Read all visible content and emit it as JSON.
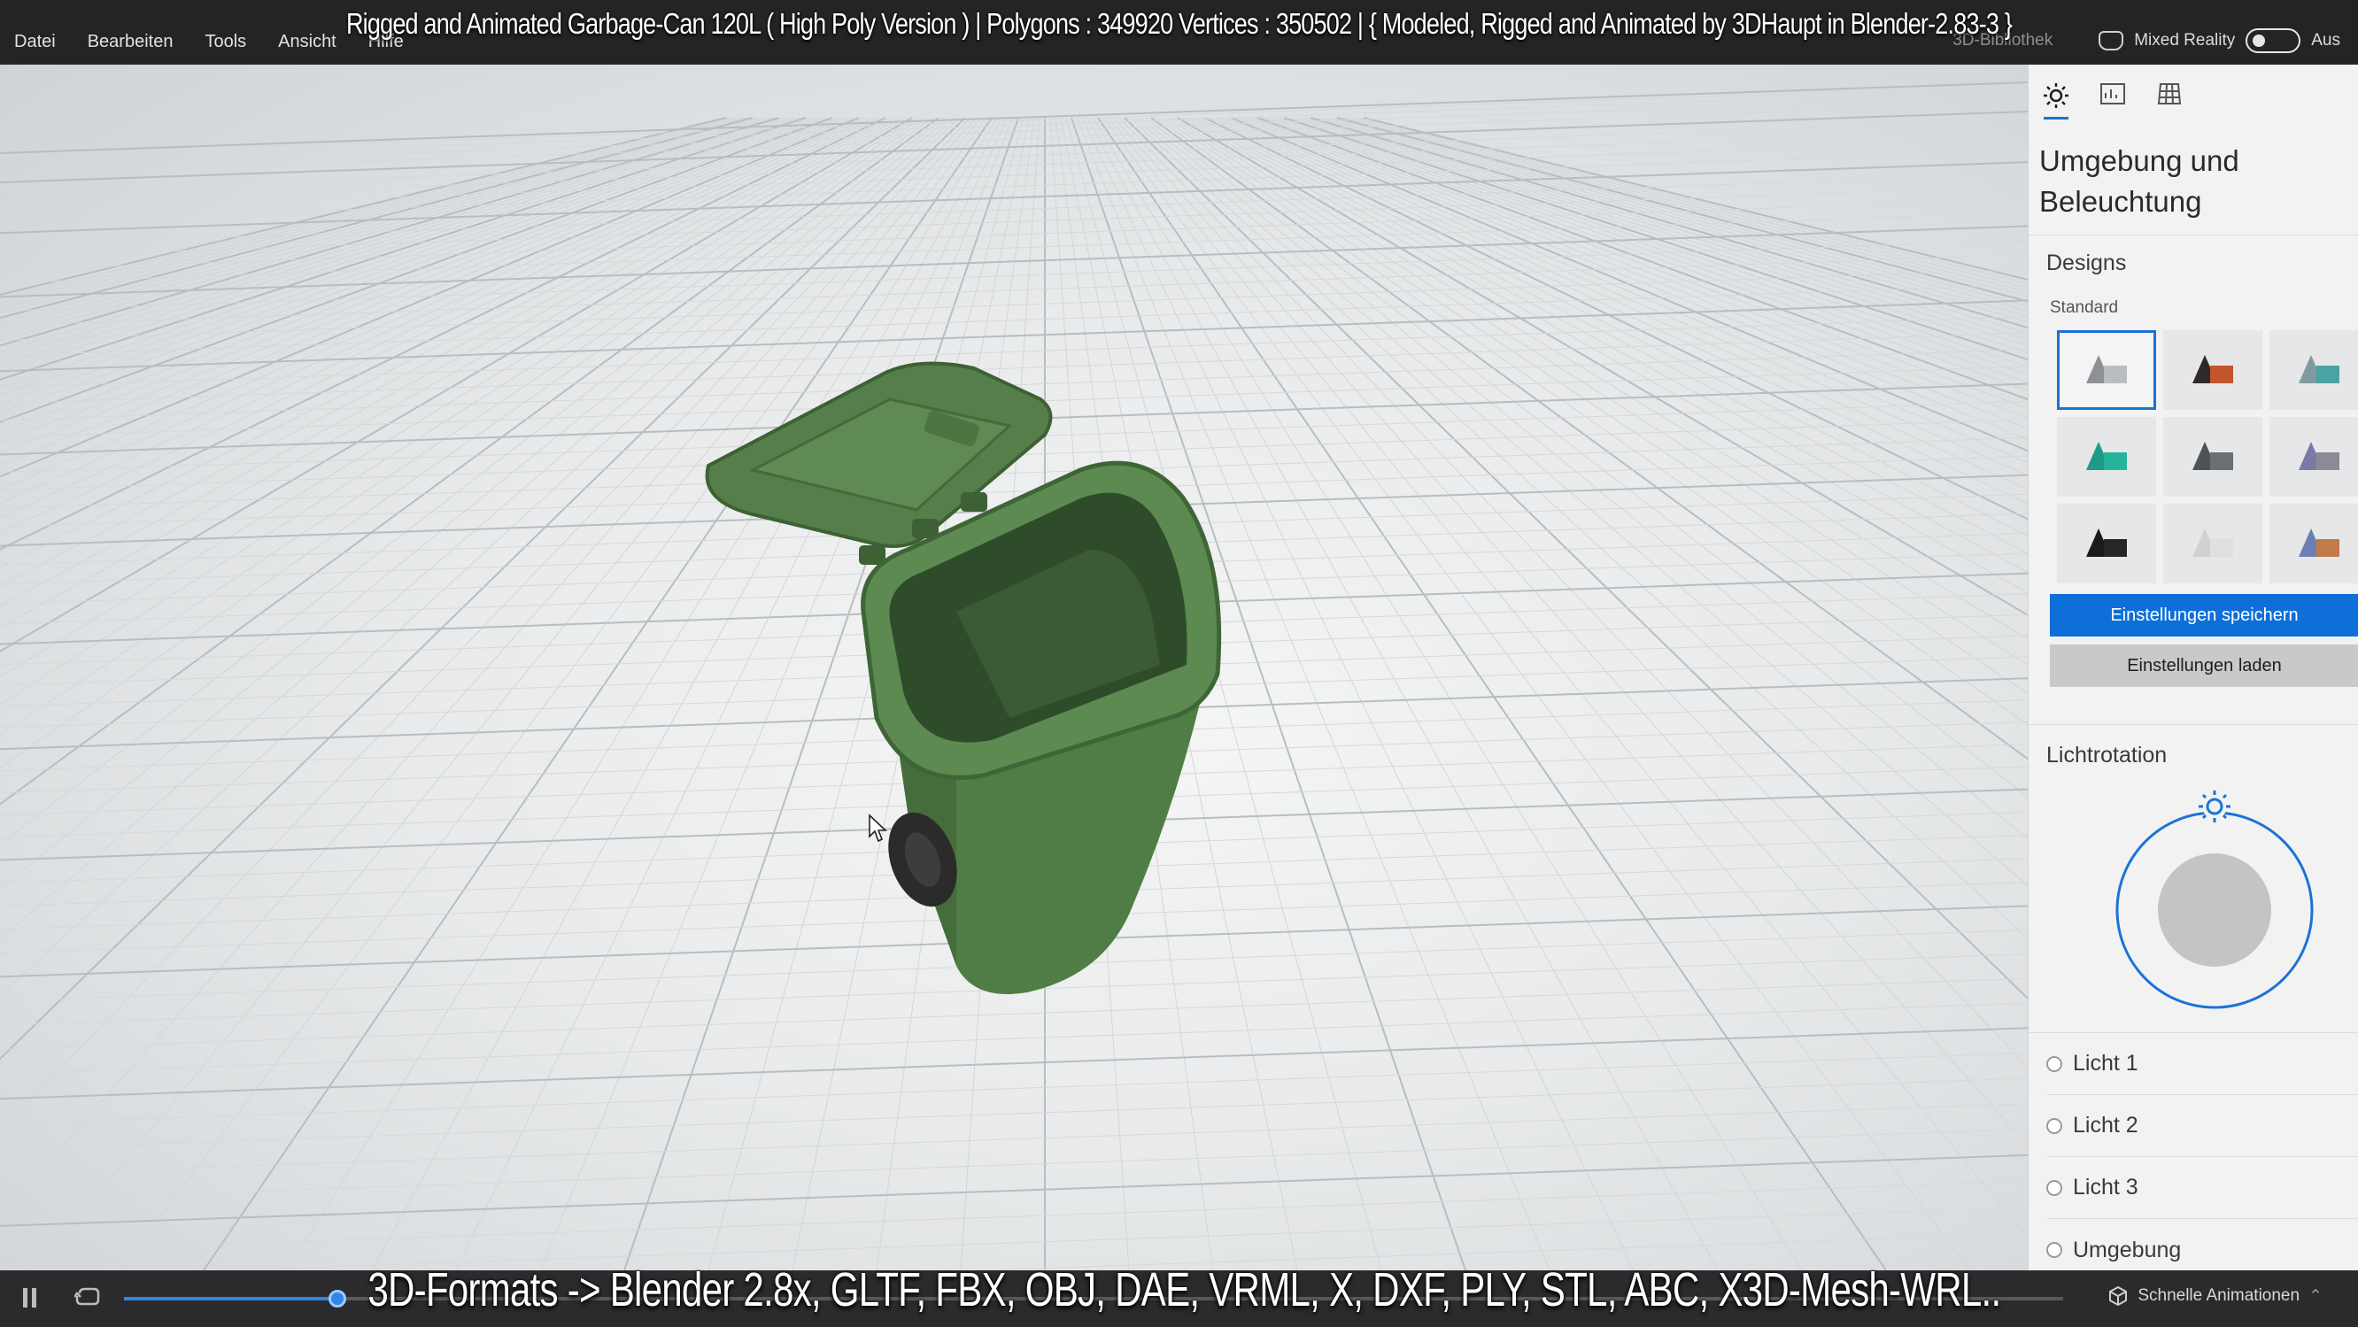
{
  "menu": {
    "items": [
      "Datei",
      "Bearbeiten",
      "Tools",
      "Ansicht",
      "Hilfe"
    ]
  },
  "overlay": {
    "title": "Rigged and Animated Garbage-Can 120L ( High Poly Version )  |  Polygons : 349920  Vertices : 350502   |   { Modeled, Rigged and Animated by 3DHaupt in Blender-2.83-3 }",
    "formats": "3D-Formats -> Blender 2.8x, GLTF, FBX, OBJ, DAE, VRML, X, DXF, PLY, STL, ABC, X3D-Mesh-WRL.."
  },
  "topright": {
    "library": "3D-Bibliothek",
    "mixed_reality": "Mixed Reality",
    "toggle_state": "Aus"
  },
  "panel": {
    "title": "Umgebung und Beleuchtung",
    "designs_heading": "Designs",
    "standard_label": "Standard",
    "save_button": "Einstellungen speichern",
    "load_button": "Einstellungen laden",
    "lightrot_heading": "Lichtrotation",
    "lights": [
      "Licht 1",
      "Licht 2",
      "Licht 3",
      "Umgebung"
    ],
    "themes": [
      {
        "name": "theme-grey",
        "cone": "#8d9196",
        "box": "#b9bcc0",
        "selected": true
      },
      {
        "name": "theme-orange",
        "cone": "#2e2a2a",
        "box": "#c2552e",
        "selected": false
      },
      {
        "name": "theme-teal-a",
        "cone": "#7f9aa0",
        "box": "#4aa3a2",
        "selected": false
      },
      {
        "name": "theme-teal-b",
        "cone": "#1e9b88",
        "box": "#27b39a",
        "selected": false
      },
      {
        "name": "theme-darkgrey",
        "cone": "#4e5256",
        "box": "#6b6f73",
        "selected": false
      },
      {
        "name": "theme-purple",
        "cone": "#7b7aa6",
        "box": "#8b8b97",
        "selected": false
      },
      {
        "name": "theme-black",
        "cone": "#1b1b1b",
        "box": "#262626",
        "selected": false
      },
      {
        "name": "theme-white",
        "cone": "#cfd1d3",
        "box": "#dfe0e1",
        "selected": false
      },
      {
        "name": "theme-multi",
        "cone": "#6c7fb5",
        "box": "#c27a4a",
        "selected": false
      }
    ]
  },
  "bottom": {
    "animations_label": "Schnelle Animationen",
    "timeline_progress": 0.11
  },
  "colors": {
    "accent": "#1a73d6",
    "can_green": "#4f7d45"
  }
}
